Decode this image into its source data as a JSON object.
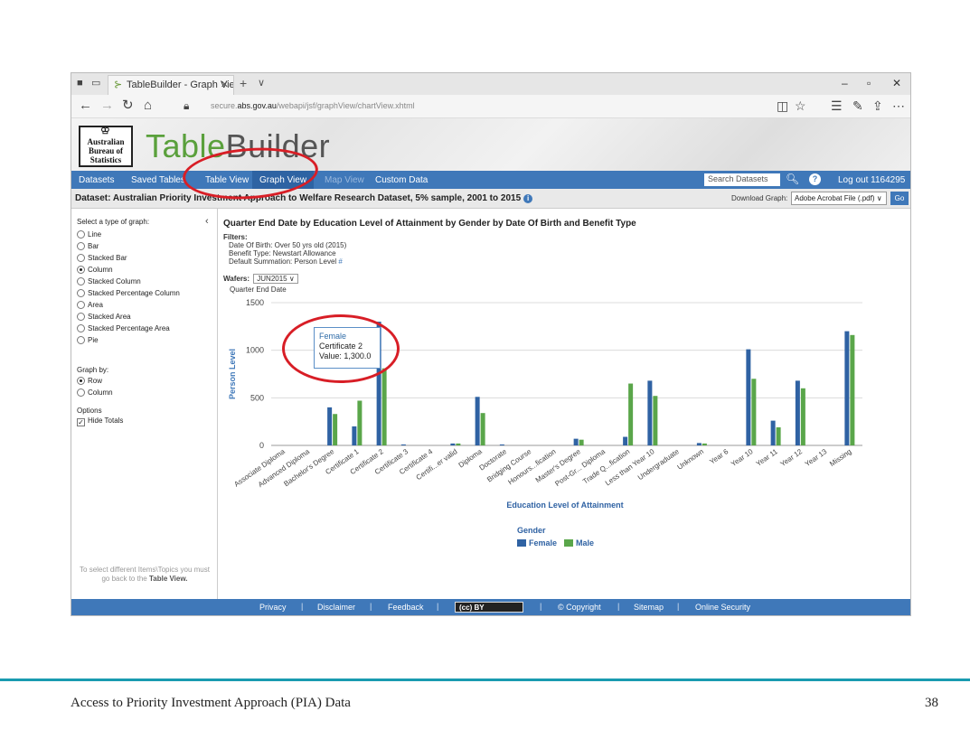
{
  "browser": {
    "tab_title": "TableBuilder - Graph Vie",
    "url_domain": "abs.gov.au",
    "url_prefix": "secure.",
    "url_path": "/webapi/jsf/graphView/chartView.xhtml"
  },
  "app": {
    "logo_lines": [
      "Australian",
      "Bureau of",
      "Statistics"
    ],
    "title_a": "Table",
    "title_b": "Builder"
  },
  "menu": {
    "datasets": "Datasets",
    "saved_tables": "Saved Tables",
    "table_view": "Table View",
    "graph_view": "Graph View",
    "map_view": "Map View",
    "custom_data": "Custom Data",
    "search_placeholder": "Search Datasets",
    "logout": "Log out 1164295"
  },
  "dataset_bar": {
    "title": "Dataset: Australian Priority Investment Approach to Welfare Research Dataset, 5% sample, 2001 to 2015",
    "download_label": "Download Graph:",
    "download_value": "Adobe Acrobat File (.pdf)",
    "go": "Go"
  },
  "left_panel": {
    "graph_type_title": "Select a type of graph:",
    "graph_types": [
      "Line",
      "Bar",
      "Stacked Bar",
      "Column",
      "Stacked Column",
      "Stacked Percentage Column",
      "Area",
      "Stacked Area",
      "Stacked Percentage Area",
      "Pie"
    ],
    "selected_graph_type": "Column",
    "graph_by_title": "Graph by:",
    "graph_by": [
      "Row",
      "Column"
    ],
    "selected_graph_by": "Row",
    "options_title": "Options",
    "hide_totals": "Hide Totals",
    "note_text": "To select different Items\\Topics you must go back to the",
    "note_link": "Table View."
  },
  "chart_header": {
    "title": "Quarter End Date by Education Level of Attainment by Gender by Date Of Birth and Benefit Type",
    "filters_label": "Filters:",
    "filter_lines": [
      "Date Of Birth: Over 50 yrs old (2015)",
      "Benefit Type: Newstart Allowance",
      "Default Summation: Person Level"
    ],
    "filter_hash": "#",
    "wafers_label": "Wafers:",
    "wafers_value": "JUN2015",
    "quarter_label": "Quarter End Date"
  },
  "tooltip": {
    "series": "Female",
    "category": "Certificate 2",
    "value_text": "Value: 1,300.0"
  },
  "chart_data": {
    "type": "bar",
    "title": "",
    "xlabel": "Education Level of Attainment",
    "ylabel": "Person Level",
    "ylim": [
      0,
      1500
    ],
    "yticks": [
      0,
      500,
      1000,
      1500
    ],
    "legend_title": "Gender",
    "legend_position": "bottom",
    "grid": true,
    "categories": [
      "Associate Diploma",
      "Advanced Diploma",
      "Bachelor's Degree",
      "Certificate 1",
      "Certificate 2",
      "Certificate 3",
      "Certificate 4",
      "Certifi...er valid",
      "Diploma",
      "Doctorate",
      "Bridging Course",
      "Honours...fication",
      "Master's Degree",
      "Post-Gr... Diploma",
      "Trade Q...fication",
      "Less than Year 10",
      "Undergraduate",
      "Unknown",
      "Year 6",
      "Year 10",
      "Year 11",
      "Year 12",
      "Year 13",
      "Missing"
    ],
    "series": [
      {
        "name": "Female",
        "color": "#2f62a3",
        "values": [
          0,
          0,
          400,
          200,
          1300,
          10,
          0,
          20,
          510,
          10,
          0,
          0,
          70,
          0,
          90,
          680,
          0,
          25,
          0,
          1010,
          260,
          680,
          0,
          1200
        ]
      },
      {
        "name": "Male",
        "color": "#5aa64a",
        "values": [
          0,
          0,
          330,
          470,
          810,
          0,
          0,
          20,
          340,
          0,
          0,
          0,
          60,
          0,
          650,
          520,
          0,
          20,
          0,
          700,
          190,
          600,
          0,
          1160
        ]
      }
    ]
  },
  "footer": {
    "items": [
      "Privacy",
      "Disclaimer",
      "Feedback",
      "© Copyright",
      "Sitemap",
      "Online Security"
    ],
    "cc": "(cc) BY"
  },
  "slide": {
    "caption": "Access to Priority Investment Approach (PIA) Data",
    "number": "38",
    "accent_color": "#1a9bb0",
    "annotation_color": "#d81e26"
  }
}
